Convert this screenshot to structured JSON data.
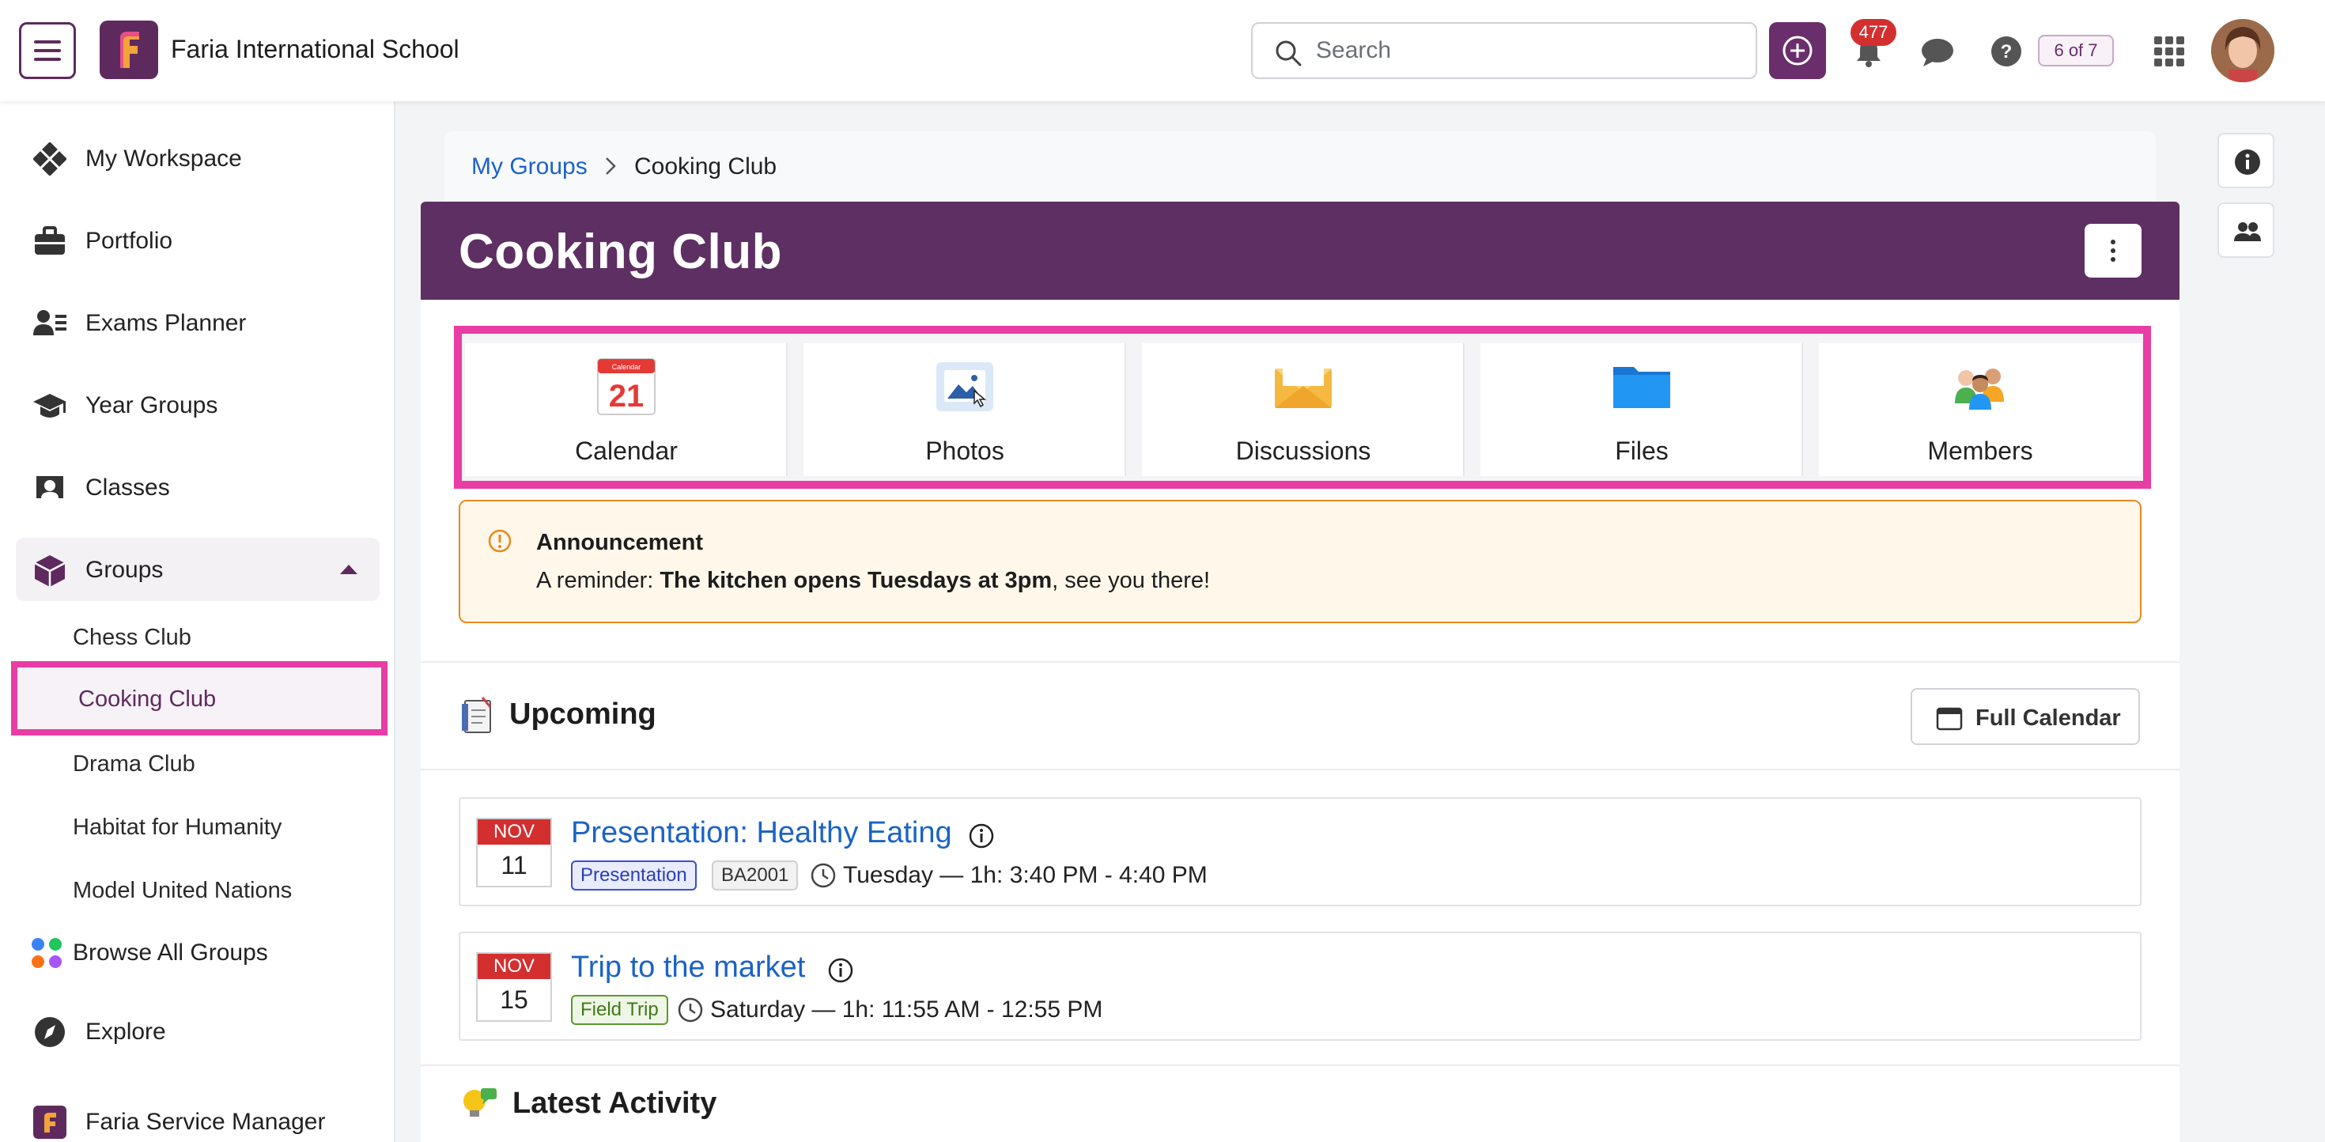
{
  "header": {
    "school_name": "Faria International School",
    "search_placeholder": "Search",
    "notification_count": "477",
    "pager": "6 of 7"
  },
  "sidebar": {
    "items": [
      {
        "label": "My Workspace",
        "icon": "workspace-icon"
      },
      {
        "label": "Portfolio",
        "icon": "briefcase-icon"
      },
      {
        "label": "Exams Planner",
        "icon": "exam-icon"
      },
      {
        "label": "Year Groups",
        "icon": "graduation-cap-icon"
      },
      {
        "label": "Classes",
        "icon": "classes-icon"
      },
      {
        "label": "Groups",
        "icon": "cube-icon"
      }
    ],
    "groups": [
      "Chess Club",
      "Cooking Club",
      "Drama Club",
      "Habitat for Humanity",
      "Model United Nations"
    ],
    "browse_all": "Browse All Groups",
    "explore": "Explore",
    "service_manager": "Faria Service Manager"
  },
  "breadcrumb": {
    "parent": "My Groups",
    "current": "Cooking Club"
  },
  "group": {
    "title": "Cooking Club"
  },
  "tiles": [
    {
      "label": "Calendar",
      "calendar_day": "21",
      "calendar_caption": "Calendar"
    },
    {
      "label": "Photos"
    },
    {
      "label": "Discussions"
    },
    {
      "label": "Files"
    },
    {
      "label": "Members"
    }
  ],
  "announcement": {
    "title": "Announcement",
    "prefix": "A reminder: ",
    "bold": "The kitchen opens Tuesdays at 3pm",
    "suffix": ", see you there!"
  },
  "upcoming": {
    "title": "Upcoming",
    "full_calendar": "Full Calendar",
    "events": [
      {
        "month": "NOV",
        "day": "11",
        "title": "Presentation: Healthy Eating",
        "tag": "Presentation",
        "room": "BA2001",
        "time": "Tuesday — 1h: 3:40 PM - 4:40 PM"
      },
      {
        "month": "NOV",
        "day": "15",
        "title": "Trip to the market",
        "tag": "Field Trip",
        "time": "Saturday — 1h: 11:55 AM - 12:55 PM"
      }
    ]
  },
  "latest_activity": {
    "title": "Latest Activity"
  },
  "colors": {
    "brand_purple": "#5e2f62",
    "highlight_pink": "#e83da4",
    "link_blue": "#1b63c6",
    "alert_orange": "#e68a1f"
  }
}
